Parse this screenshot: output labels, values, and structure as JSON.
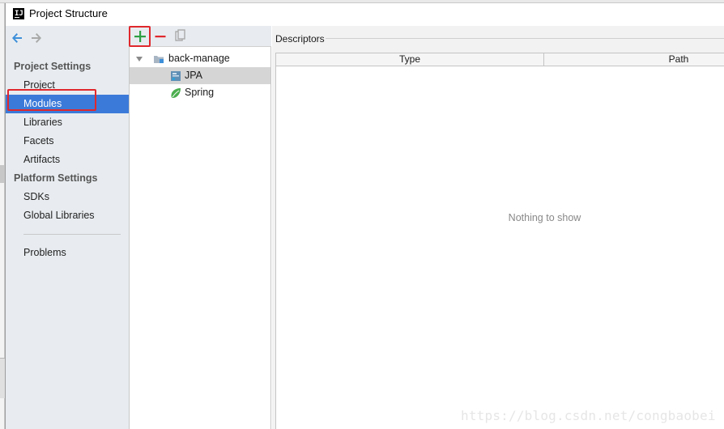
{
  "window": {
    "title": "Project Structure",
    "app_icon": "intellij-icon"
  },
  "nav": {
    "back_icon": "arrow-left-icon",
    "forward_icon": "arrow-right-icon",
    "sections": [
      {
        "title": "Project Settings",
        "items": [
          "Project",
          "Modules",
          "Libraries",
          "Facets",
          "Artifacts"
        ]
      },
      {
        "title": "Platform Settings",
        "items": [
          "SDKs",
          "Global Libraries"
        ]
      }
    ],
    "footer_items": [
      "Problems"
    ],
    "selected": "Modules"
  },
  "tree": {
    "toolbar": [
      {
        "name": "add",
        "icon": "plus-icon",
        "color": "#2ea043"
      },
      {
        "name": "remove",
        "icon": "minus-icon",
        "color": "#e0282d"
      },
      {
        "name": "copy",
        "icon": "copy-icon",
        "color": "#9a9a9a"
      }
    ],
    "root": {
      "label": "back-manage",
      "icon": "module-folder-icon",
      "expanded": true
    },
    "children": [
      {
        "label": "JPA",
        "icon": "jpa-icon",
        "selected": true
      },
      {
        "label": "Spring",
        "icon": "spring-leaf-icon",
        "selected": false
      }
    ]
  },
  "details": {
    "section_label": "Descriptors",
    "columns": [
      "Type",
      "Path"
    ],
    "empty_text": "Nothing to show"
  },
  "watermark": "https://blog.csdn.net/congbaobei",
  "colors": {
    "selection": "#3b7ad9",
    "highlight_box": "#e0282d",
    "nav_bg": "#e8ecf0"
  }
}
